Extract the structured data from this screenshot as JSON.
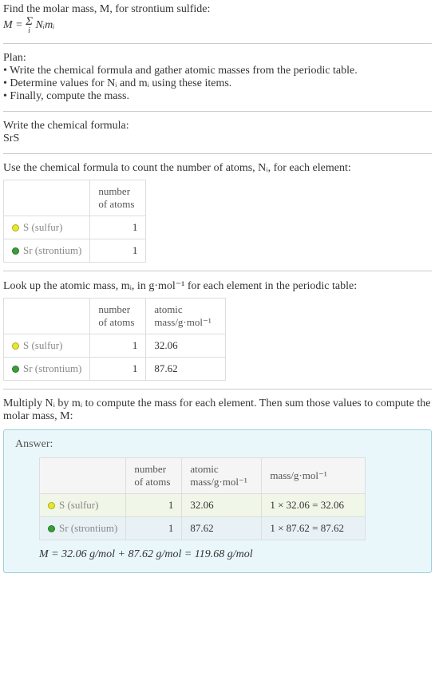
{
  "intro": {
    "line1": "Find the molar mass, M, for strontium sulfide:",
    "line2_prefix": "M = ",
    "line2_sum": "Σ",
    "line2_idx": "i",
    "line2_rest": " Nᵢmᵢ"
  },
  "plan": {
    "heading": "Plan:",
    "item1": "• Write the chemical formula and gather atomic masses from the periodic table.",
    "item2": "• Determine values for Nᵢ and mᵢ using these items.",
    "item3": "• Finally, compute the mass."
  },
  "chemformula": {
    "heading": "Write the chemical formula:",
    "value": "SrS"
  },
  "count": {
    "heading": "Use the chemical formula to count the number of atoms, Nᵢ, for each element:",
    "col_atoms": "number of atoms",
    "rows": [
      {
        "name": "S (sulfur)",
        "atoms": "1"
      },
      {
        "name": "Sr (strontium)",
        "atoms": "1"
      }
    ]
  },
  "lookup": {
    "heading": "Look up the atomic mass, mᵢ, in g·mol⁻¹ for each element in the periodic table:",
    "col_atoms": "number of atoms",
    "col_mass": "atomic mass/g·mol⁻¹",
    "rows": [
      {
        "name": "S (sulfur)",
        "atoms": "1",
        "mass": "32.06"
      },
      {
        "name": "Sr (strontium)",
        "atoms": "1",
        "mass": "87.62"
      }
    ]
  },
  "multiply": {
    "heading": "Multiply Nᵢ by mᵢ to compute the mass for each element. Then sum those values to compute the molar mass, M:"
  },
  "answer": {
    "label": "Answer:",
    "col_atoms": "number of atoms",
    "col_amass": "atomic mass/g·mol⁻¹",
    "col_mass": "mass/g·mol⁻¹",
    "rows": [
      {
        "name": "S (sulfur)",
        "atoms": "1",
        "amass": "32.06",
        "mass": "1 × 32.06 = 32.06"
      },
      {
        "name": "Sr (strontium)",
        "atoms": "1",
        "amass": "87.62",
        "mass": "1 × 87.62 = 87.62"
      }
    ],
    "formula": "M = 32.06 g/mol + 87.62 g/mol = 119.68 g/mol"
  }
}
